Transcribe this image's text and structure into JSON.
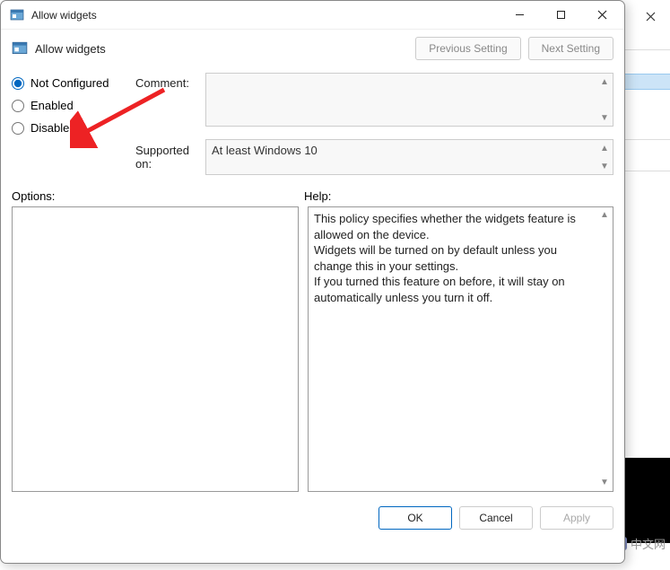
{
  "window": {
    "title": "Allow widgets",
    "header_title": "Allow widgets",
    "prev_button": "Previous Setting",
    "next_button": "Next Setting"
  },
  "radios": {
    "not_configured": "Not Configured",
    "enabled": "Enabled",
    "disabled": "Disabled",
    "selected": "not_configured"
  },
  "labels": {
    "comment": "Comment:",
    "supported_on": "Supported on:",
    "options": "Options:",
    "help": "Help:"
  },
  "fields": {
    "comment": "",
    "supported_on": "At least Windows 10"
  },
  "help_text": "This policy specifies whether the widgets feature is allowed on the device.\nWidgets will be turned on by default unless you change this in your settings.\nIf you turned this feature on before, it will stay on automatically unless you turn it off.",
  "buttons": {
    "ok": "OK",
    "cancel": "Cancel",
    "apply": "Apply"
  },
  "watermark": {
    "logo": "php",
    "text": "中文网"
  }
}
